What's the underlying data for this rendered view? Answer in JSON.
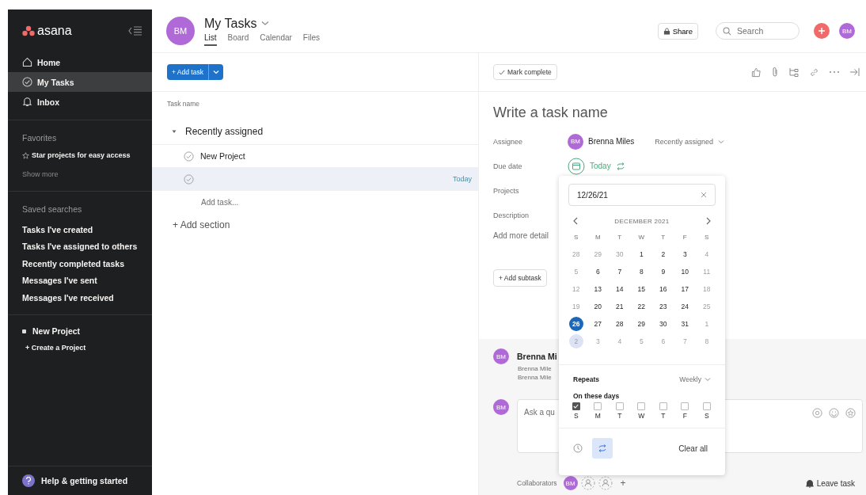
{
  "sidebar": {
    "logo": "asana",
    "nav": [
      {
        "label": "Home",
        "selected": false
      },
      {
        "label": "My Tasks",
        "selected": true
      },
      {
        "label": "Inbox",
        "selected": false
      }
    ],
    "favorites": {
      "heading": "Favorites",
      "hint": "Star projects for easy access",
      "show_more": "Show more"
    },
    "saved_searches": {
      "heading": "Saved searches",
      "items": [
        "Tasks I've created",
        "Tasks I've assigned to others",
        "Recently completed tasks",
        "Messages I've sent",
        "Messages I've received"
      ]
    },
    "projects": [
      "New Project"
    ],
    "create_project": "+ Create a Project",
    "help": "Help & getting started"
  },
  "header": {
    "avatar": "BM",
    "title": "My Tasks",
    "tabs": [
      {
        "label": "List",
        "selected": true
      },
      {
        "label": "Board",
        "selected": false
      },
      {
        "label": "Calendar",
        "selected": false
      },
      {
        "label": "Files",
        "selected": false
      }
    ],
    "share": "Share",
    "search_placeholder": "Search",
    "profile_avatar": "BM"
  },
  "list": {
    "add_task": "+ Add task",
    "column": "Task name",
    "section": {
      "title": "Recently assigned",
      "expanded": true
    },
    "tasks": [
      {
        "name": "New Project",
        "selected": false
      },
      {
        "due": "Today",
        "selected": true
      }
    ],
    "add_task_inline": "Add task...",
    "add_section": "+ Add section"
  },
  "detail": {
    "mark_complete": "Mark complete",
    "title_placeholder": "Write a task name",
    "assignee": {
      "label": "Assignee",
      "avatar": "BM",
      "name": "Brenna Miles",
      "section": "Recently assigned"
    },
    "due_date": {
      "label": "Due date",
      "value": "Today"
    },
    "projects_label": "Projects",
    "description_label": "Description",
    "description_placeholder": "Add more detail",
    "add_subtask": "+ Add subtask",
    "activity": {
      "avatar": "BM",
      "author": "Brenna Mi",
      "lines": [
        "Brenna Mile",
        "Brenna Mile"
      ]
    },
    "comment": {
      "avatar": "BM",
      "placeholder": "Ask a qu"
    },
    "collaborators": {
      "label": "Collaborators",
      "avatar": "BM",
      "add": "+"
    },
    "leave": "Leave task"
  },
  "date_picker": {
    "input": "12/26/21",
    "month": "DECEMBER 2021",
    "weekdays": [
      "S",
      "M",
      "T",
      "W",
      "T",
      "F",
      "S"
    ],
    "weeks": [
      [
        {
          "day": "28",
          "muted": true,
          "selected": false,
          "highlighted": false
        },
        {
          "day": "29",
          "muted": true,
          "selected": false,
          "highlighted": false
        },
        {
          "day": "30",
          "muted": true,
          "selected": false,
          "highlighted": false
        },
        {
          "day": "1",
          "muted": false,
          "selected": false,
          "highlighted": false
        },
        {
          "day": "2",
          "muted": false,
          "selected": false,
          "highlighted": false
        },
        {
          "day": "3",
          "muted": false,
          "selected": false,
          "highlighted": false
        },
        {
          "day": "4",
          "muted": true,
          "selected": false,
          "highlighted": false
        }
      ],
      [
        {
          "day": "5",
          "muted": true,
          "selected": false,
          "highlighted": false
        },
        {
          "day": "6",
          "muted": false,
          "selected": false,
          "highlighted": false
        },
        {
          "day": "7",
          "muted": false,
          "selected": false,
          "highlighted": false
        },
        {
          "day": "8",
          "muted": false,
          "selected": false,
          "highlighted": false
        },
        {
          "day": "9",
          "muted": false,
          "selected": false,
          "highlighted": false
        },
        {
          "day": "10",
          "muted": false,
          "selected": false,
          "highlighted": false
        },
        {
          "day": "11",
          "muted": true,
          "selected": false,
          "highlighted": false
        }
      ],
      [
        {
          "day": "12",
          "muted": true,
          "selected": false,
          "highlighted": false
        },
        {
          "day": "13",
          "muted": false,
          "selected": false,
          "highlighted": false
        },
        {
          "day": "14",
          "muted": false,
          "selected": false,
          "highlighted": false
        },
        {
          "day": "15",
          "muted": false,
          "selected": false,
          "highlighted": false
        },
        {
          "day": "16",
          "muted": false,
          "selected": false,
          "highlighted": false
        },
        {
          "day": "17",
          "muted": false,
          "selected": false,
          "highlighted": false
        },
        {
          "day": "18",
          "muted": true,
          "selected": false,
          "highlighted": false
        }
      ],
      [
        {
          "day": "19",
          "muted": true,
          "selected": false,
          "highlighted": false
        },
        {
          "day": "20",
          "muted": false,
          "selected": false,
          "highlighted": false
        },
        {
          "day": "21",
          "muted": false,
          "selected": false,
          "highlighted": false
        },
        {
          "day": "22",
          "muted": false,
          "selected": false,
          "highlighted": false
        },
        {
          "day": "23",
          "muted": false,
          "selected": false,
          "highlighted": false
        },
        {
          "day": "24",
          "muted": false,
          "selected": false,
          "highlighted": false
        },
        {
          "day": "25",
          "muted": true,
          "selected": false,
          "highlighted": false
        }
      ],
      [
        {
          "day": "26",
          "muted": false,
          "selected": true,
          "highlighted": false
        },
        {
          "day": "27",
          "muted": false,
          "selected": false,
          "highlighted": false
        },
        {
          "day": "28",
          "muted": false,
          "selected": false,
          "highlighted": false
        },
        {
          "day": "29",
          "muted": false,
          "selected": false,
          "highlighted": false
        },
        {
          "day": "30",
          "muted": false,
          "selected": false,
          "highlighted": false
        },
        {
          "day": "31",
          "muted": false,
          "selected": false,
          "highlighted": false
        },
        {
          "day": "1",
          "muted": true,
          "selected": false,
          "highlighted": false
        }
      ],
      [
        {
          "day": "2",
          "muted": true,
          "selected": false,
          "highlighted": true
        },
        {
          "day": "3",
          "muted": true,
          "selected": false,
          "highlighted": false
        },
        {
          "day": "4",
          "muted": true,
          "selected": false,
          "highlighted": false
        },
        {
          "day": "5",
          "muted": true,
          "selected": false,
          "highlighted": false
        },
        {
          "day": "6",
          "muted": true,
          "selected": false,
          "highlighted": false
        },
        {
          "day": "7",
          "muted": true,
          "selected": false,
          "highlighted": false
        },
        {
          "day": "8",
          "muted": true,
          "selected": false,
          "highlighted": false
        }
      ]
    ],
    "repeats_label": "Repeats",
    "repeats_value": "Weekly",
    "days_label": "On these days",
    "days": [
      {
        "label": "S",
        "checked": true
      },
      {
        "label": "M",
        "checked": false
      },
      {
        "label": "T",
        "checked": false
      },
      {
        "label": "W",
        "checked": false
      },
      {
        "label": "T",
        "checked": false
      },
      {
        "label": "F",
        "checked": false
      },
      {
        "label": "S",
        "checked": false
      }
    ],
    "repeat_on": true,
    "clear": "Clear all"
  }
}
